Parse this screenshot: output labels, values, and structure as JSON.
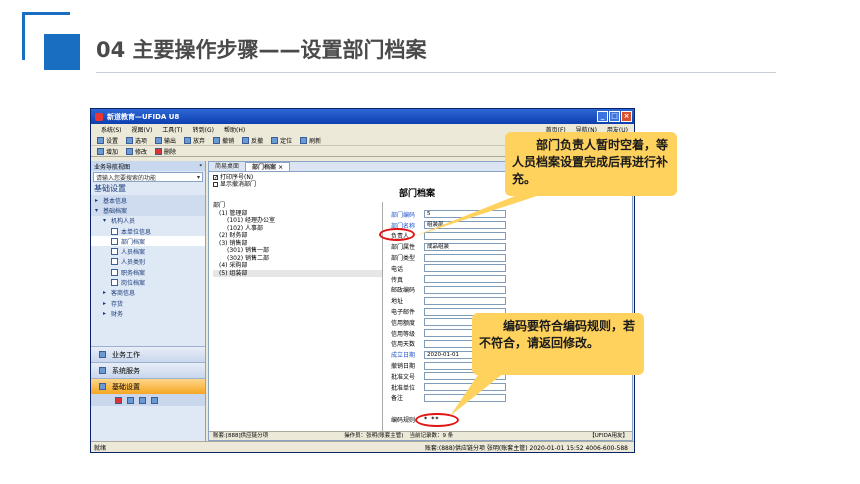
{
  "slide": {
    "title": "04  主要操作步骤——设置部门档案"
  },
  "window": {
    "title": "新道教育—UFIDA U8",
    "menu": [
      "系统(S)",
      "视图(V)",
      "工具(T)",
      "转到(G)",
      "帮助(H)"
    ],
    "menu_right": [
      "首页(F)",
      "导航(N)",
      "用友(U)"
    ],
    "toolbar1": [
      "设置",
      "选项",
      "输出",
      "放弃",
      "撤销",
      "定位",
      "刷新",
      "反撤"
    ],
    "toolbar2": [
      "增加",
      "修改",
      "删除"
    ]
  },
  "nav": {
    "header": "业务导航视图",
    "search_placeholder": "请输入您要搜索的功能",
    "title": "基础设置",
    "items": [
      {
        "label": "基本信息",
        "level": 0,
        "arrow": "▸"
      },
      {
        "label": "基础档案",
        "level": 0,
        "arrow": "▾"
      },
      {
        "label": "机构人员",
        "level": 1,
        "arrow": "▾"
      },
      {
        "label": "本单位信息",
        "level": 2,
        "arrow": ""
      },
      {
        "label": "部门档案",
        "level": 2,
        "arrow": ""
      },
      {
        "label": "人员档案",
        "level": 2,
        "arrow": ""
      },
      {
        "label": "人员类别",
        "level": 2,
        "arrow": ""
      },
      {
        "label": "职务档案",
        "level": 2,
        "arrow": ""
      },
      {
        "label": "岗位档案",
        "level": 2,
        "arrow": ""
      },
      {
        "label": "客商信息",
        "level": 1,
        "arrow": "▸"
      },
      {
        "label": "存货",
        "level": 1,
        "arrow": "▸"
      },
      {
        "label": "财务",
        "level": 1,
        "arrow": "▸"
      }
    ],
    "btn_business": "业务工作",
    "btn_system": "系统服务",
    "btn_basic": "基础设置"
  },
  "tabs": [
    "简易桌面",
    "部门档案 ×"
  ],
  "options": {
    "print_serial": "打印序号(N)",
    "show_revoked": "显示撤消部门"
  },
  "form_title": "部门档案",
  "tree": [
    "部门",
    "(1) 管理部",
    "(101) 经理办公室",
    "(102) 人事部",
    "(2) 财务部",
    "(3) 销售部",
    "(301) 销售一部",
    "(302) 销售二部",
    "(4) 采购部",
    "(5) 组装部"
  ],
  "form": {
    "fields": [
      {
        "label": "部门编码",
        "value": "5",
        "blue": true
      },
      {
        "label": "部门名称",
        "value": "组装部",
        "blue": true
      },
      {
        "label": "负责人",
        "value": "",
        "blue": false
      },
      {
        "label": "部门属性",
        "value": "成品组装",
        "blue": false
      },
      {
        "label": "部门类型",
        "value": "",
        "blue": false
      },
      {
        "label": "电话",
        "value": "",
        "blue": false
      },
      {
        "label": "传真",
        "value": "",
        "blue": false
      },
      {
        "label": "邮政编码",
        "value": "",
        "blue": false
      },
      {
        "label": "地址",
        "value": "",
        "blue": false
      },
      {
        "label": "电子邮件",
        "value": "",
        "blue": false
      },
      {
        "label": "信用额度",
        "value": "",
        "blue": false
      },
      {
        "label": "信用等级",
        "value": "",
        "blue": false
      },
      {
        "label": "信用天数",
        "value": "",
        "blue": false
      },
      {
        "label": "成立日期",
        "value": "2020-01-01",
        "blue": true
      },
      {
        "label": "撤销日期",
        "value": "",
        "blue": false
      },
      {
        "label": "批准文号",
        "value": "",
        "blue": false
      },
      {
        "label": "批准单位",
        "value": "",
        "blue": false
      },
      {
        "label": "备注",
        "value": "",
        "blue": false
      }
    ],
    "code_rule_label": "编码规则",
    "code_rule_value": "* **"
  },
  "status": {
    "unit": "账套:[888]供应链分项",
    "operator": "操作员：张明(账套主管)",
    "count": "当前记录数：9 条",
    "brand": "【UFIDA用友】"
  },
  "bottom": {
    "left": "就绪",
    "right": "账套:(888)供应链分项  张明(账套主管)  2020-01-01 15:52  4006-600-588"
  },
  "callouts": {
    "top": "部门负责人暂时空着，等人员档案设置完成后再进行补充。",
    "bottom": "编码要符合编码规则，若不符合，请返回修改。"
  },
  "colors": {
    "accent": "#1a6ec2",
    "callout": "#ffd25e",
    "highlight": "#e21313"
  }
}
